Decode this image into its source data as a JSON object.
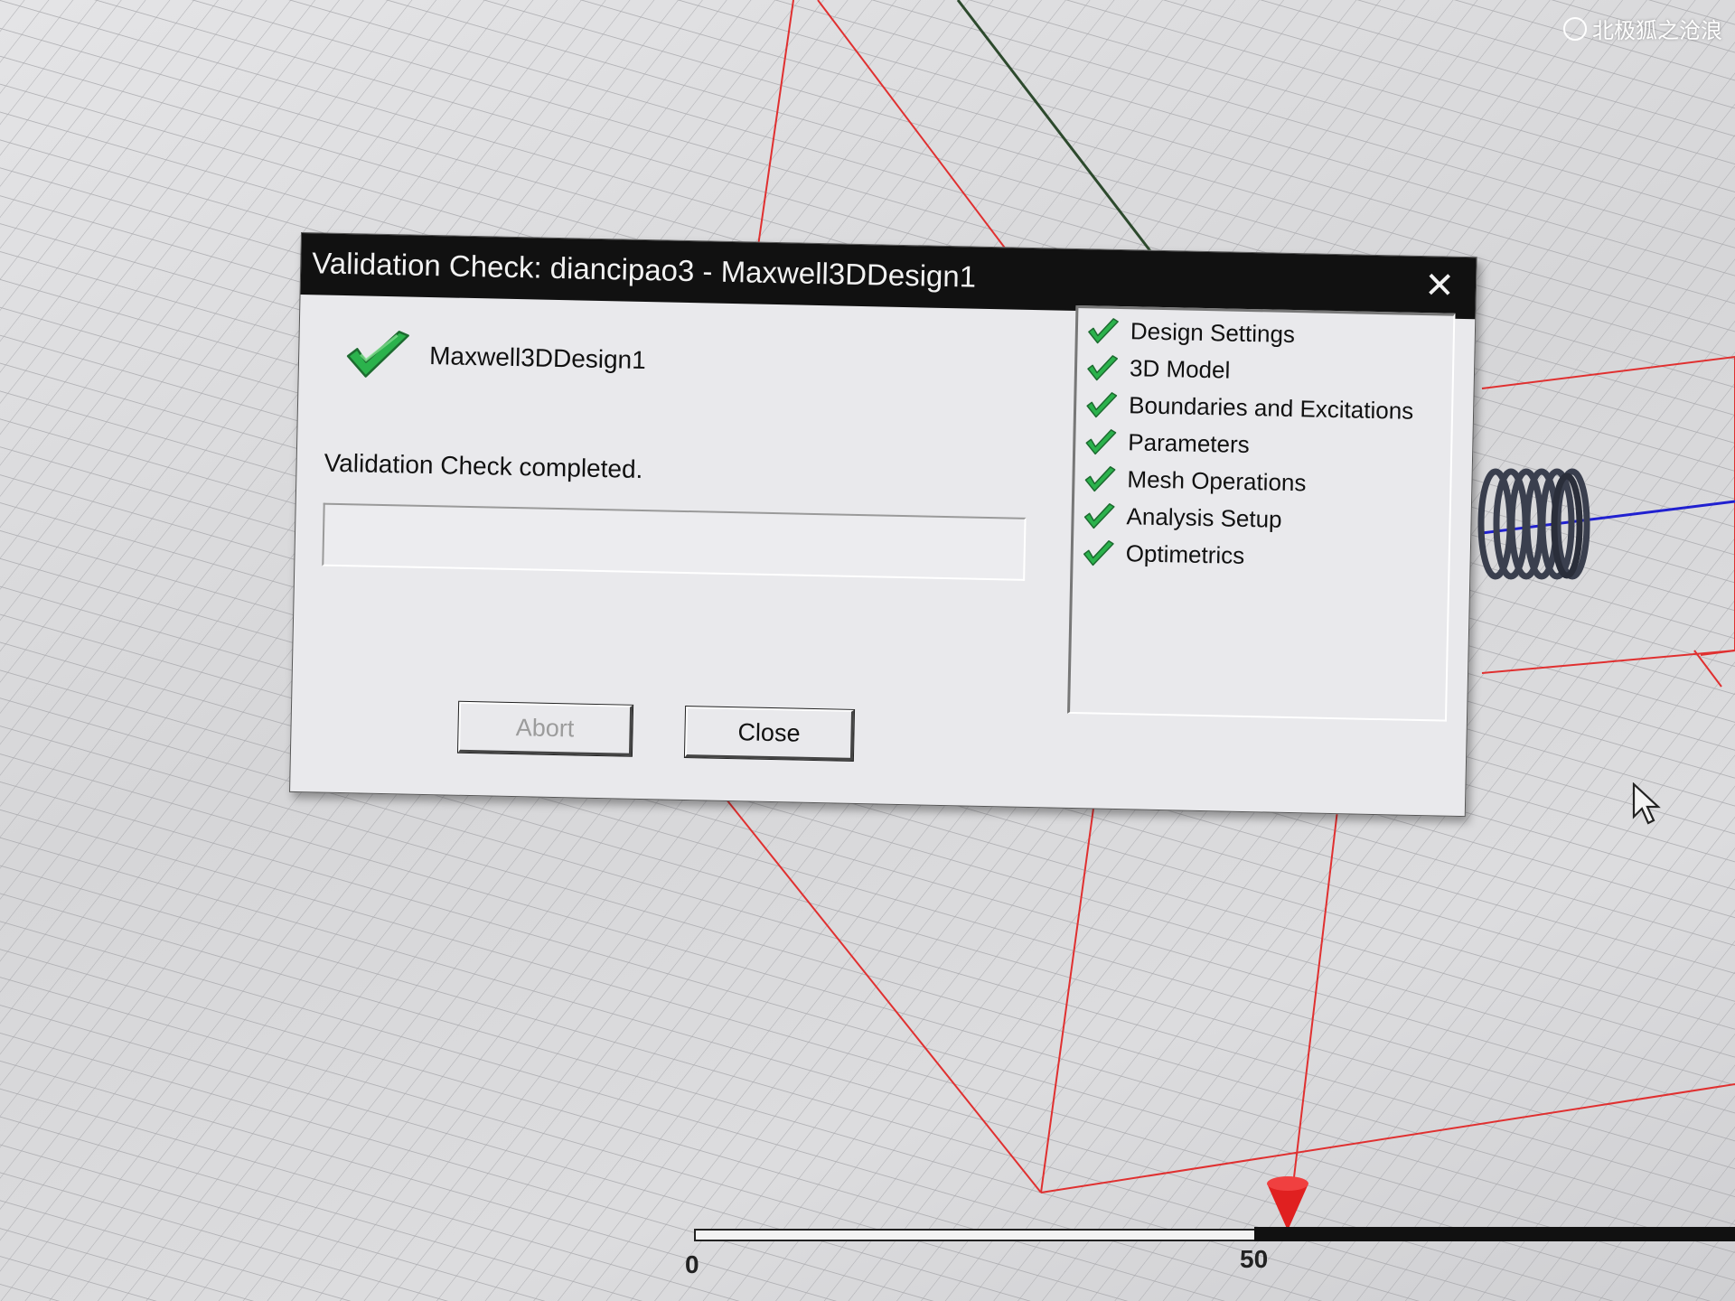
{
  "watermark": {
    "text": "北极狐之沧浪"
  },
  "viewport": {
    "ruler": {
      "labels": [
        "0",
        "50"
      ]
    }
  },
  "dialog": {
    "title": "Validation Check: diancipao3 - Maxwell3DDesign1",
    "design_name": "Maxwell3DDesign1",
    "status": "Validation Check completed.",
    "buttons": {
      "abort": "Abort",
      "close": "Close"
    },
    "check_items": [
      {
        "label": "Design Settings",
        "status": "passed"
      },
      {
        "label": "3D Model",
        "status": "passed"
      },
      {
        "label": "Boundaries and Excitations",
        "status": "passed"
      },
      {
        "label": "Parameters",
        "status": "passed"
      },
      {
        "label": "Mesh Operations",
        "status": "passed"
      },
      {
        "label": "Analysis Setup",
        "status": "passed"
      },
      {
        "label": "Optimetrics",
        "status": "passed"
      }
    ]
  },
  "colors": {
    "check_green": "#2bb24c",
    "title_bar": "#111111",
    "region_outline": "#e03030",
    "axis_blue": "#2020d0",
    "coil": "#3a3f4e"
  }
}
